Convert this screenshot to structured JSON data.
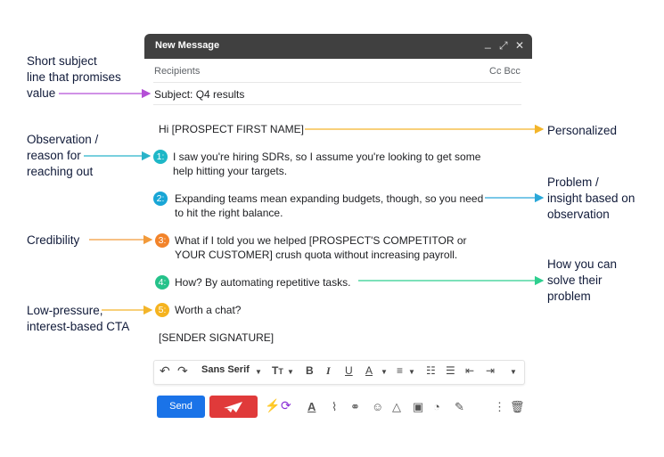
{
  "annotations": {
    "subject": "Short subject\nline that promises\nvalue",
    "observation": "Observation /\nreason for\nreaching out",
    "credibility": "Credibility",
    "low_pressure": "Low-pressure,\ninterest-based CTA",
    "personalized": "Personalized",
    "problem": "Problem /\ninsight based on\nobservation",
    "solve": "How you can\nsolve their\nproblem"
  },
  "compose": {
    "title": "New Message",
    "min_icon": "_",
    "expand_icon": "⤢",
    "close_icon": "✕",
    "recipients_placeholder": "Recipients",
    "cc_bcc": "Cc Bcc",
    "subject": "Subject: Q4 results",
    "greeting": "Hi [PROSPECT FIRST NAME]",
    "steps": [
      {
        "num": "1:",
        "text": "I saw you're hiring SDRs, so I assume you're looking to get some\nhelp hitting your targets.",
        "color": "#1eb7c7"
      },
      {
        "num": "2:",
        "text": "Expanding teams mean expanding budgets, though, so you need\nto hit the right balance.",
        "color": "#19a6d6"
      },
      {
        "num": "3:",
        "text": "What if I told you we helped [PROSPECT'S COMPETITOR or\nYOUR CUSTOMER] crush quota without increasing payroll.",
        "color": "#f2832a"
      },
      {
        "num": "4:",
        "text": "How? By automating repetitive tasks.",
        "color": "#25c28a"
      },
      {
        "num": "5:",
        "text": "Worth a chat?",
        "color": "#f5b31f"
      }
    ],
    "signature": "[SENDER SIGNATURE]"
  },
  "toolbar": {
    "font": "Sans Serif"
  },
  "bottom": {
    "send_label": "Send"
  },
  "colors": {
    "subject_arrow": "#b44fd6",
    "teal_arrow": "#29b3c9",
    "blue_arrow": "#2aa8d9",
    "orange_arrow": "#f29a3a",
    "green_arrow": "#2ecf8f",
    "yellow_arrow": "#f3b52a",
    "send": "#1a73e8",
    "red": "#e03a3a"
  }
}
